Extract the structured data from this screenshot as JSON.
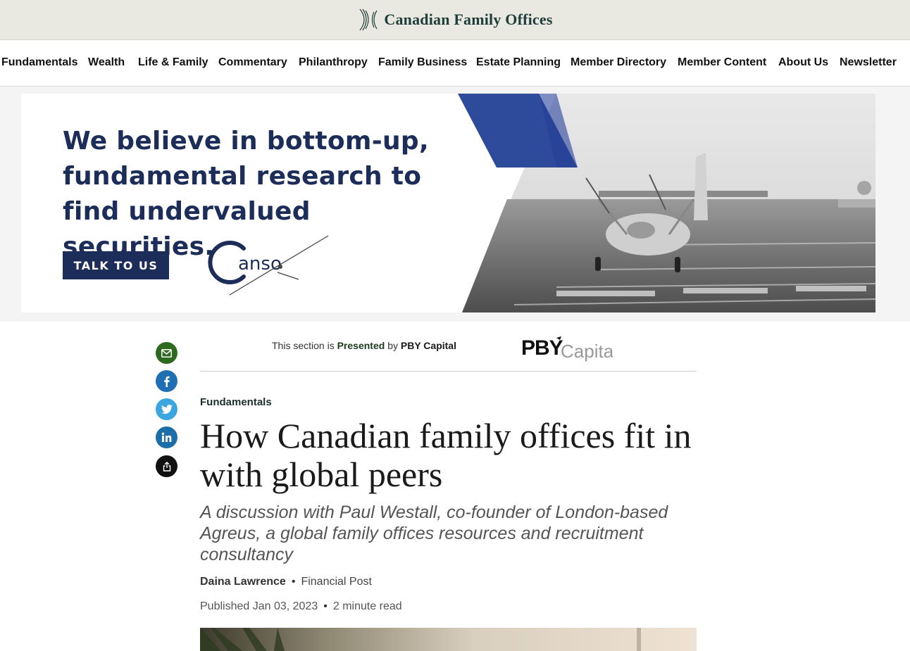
{
  "site": {
    "brand_name": "Canadian Family Offices",
    "brand_icon": "fan-lines-logo-icon"
  },
  "nav": {
    "items": [
      {
        "label": "Fundamentals"
      },
      {
        "label": "Wealth"
      },
      {
        "label": "Life & Family"
      },
      {
        "label": "Commentary"
      },
      {
        "label": "Philanthropy"
      },
      {
        "label": "Family Business"
      },
      {
        "label": "Estate Planning"
      },
      {
        "label": "Member Directory"
      },
      {
        "label": "Member Content"
      },
      {
        "label": "About Us"
      },
      {
        "label": "Newsletter"
      }
    ]
  },
  "ad": {
    "headline": "We believe in bottom-up, fundamental research to find undervalued securities.",
    "cta_label": "TALK TO US",
    "logo_text": "anso",
    "colors": {
      "navy": "#1c2d5a",
      "stripe_blue": "#2e4a9a"
    }
  },
  "share": {
    "buttons": [
      {
        "name": "email-icon",
        "color": "#2d6a1f"
      },
      {
        "name": "facebook-icon",
        "color": "#1f6fb5"
      },
      {
        "name": "twitter-icon",
        "color": "#3aa6e0"
      },
      {
        "name": "linkedin-icon",
        "color": "#1b6ea8"
      },
      {
        "name": "share-icon",
        "color": "#111111"
      }
    ]
  },
  "sponsor": {
    "prefix": "This section is",
    "presented": "Presented",
    "by": "by",
    "name": "PBY Capital",
    "logo_bold": "PBY",
    "logo_light": "Capital"
  },
  "article": {
    "category": "Fundamentals",
    "title": "How Canadian family offices fit in with global peers",
    "dek": "A discussion with Paul Westall, co-founder of London-based Agreus, a global family offices resources and recruitment consultancy",
    "author": "Daina Lawrence",
    "publication": "Financial Post",
    "published": "Published Jan 03, 2023",
    "read_time": "2 minute read"
  }
}
